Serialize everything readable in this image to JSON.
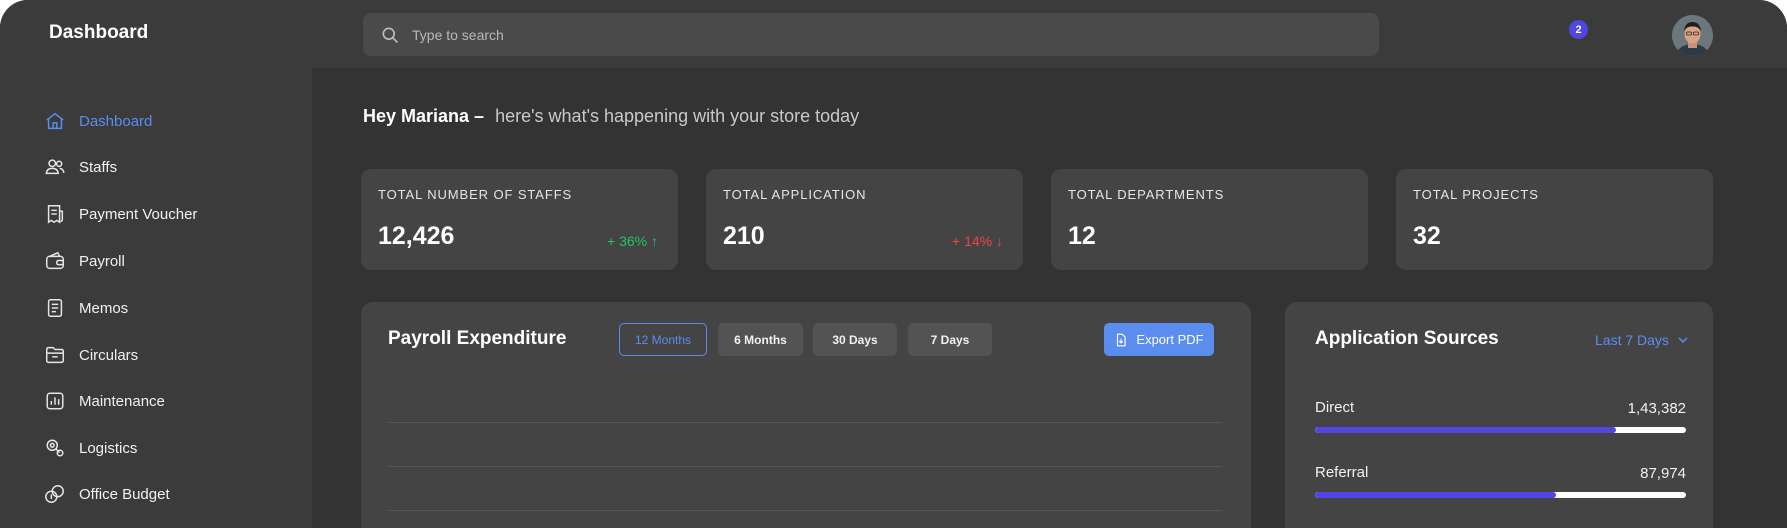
{
  "app": {
    "brand": "Dashboard"
  },
  "search": {
    "placeholder": "Type to search"
  },
  "notifications": {
    "count": "2"
  },
  "sidebar": {
    "items": [
      {
        "label": "Dashboard",
        "icon": "home-icon",
        "active": true
      },
      {
        "label": "Staffs",
        "icon": "users-icon"
      },
      {
        "label": "Payment Voucher",
        "icon": "receipt-icon"
      },
      {
        "label": "Payroll",
        "icon": "wallet-icon"
      },
      {
        "label": "Memos",
        "icon": "document-icon"
      },
      {
        "label": "Circulars",
        "icon": "folder-icon"
      },
      {
        "label": "Maintenance",
        "icon": "bar-chart-icon"
      },
      {
        "label": "Logistics",
        "icon": "logistics-icon"
      },
      {
        "label": "Office Budget",
        "icon": "coins-icon"
      }
    ]
  },
  "greeting": {
    "name": "Hey Mariana –",
    "message": "here's what's happening with your store today"
  },
  "stats": [
    {
      "title": "TOTAL NUMBER OF STAFFS",
      "value": "12,426",
      "delta": "+ 36% ↑",
      "delta_color": "#22c55e"
    },
    {
      "title": "TOTAL APPLICATION",
      "value": "210",
      "delta": "+ 14% ↓",
      "delta_color": "#ef4444"
    },
    {
      "title": "TOTAL DEPARTMENTS",
      "value": "12",
      "delta": ""
    },
    {
      "title": "TOTAL PROJECTS",
      "value": "32",
      "delta": ""
    }
  ],
  "payroll": {
    "title": "Payroll Expenditure",
    "tabs": [
      {
        "label": "12 Months",
        "active": true
      },
      {
        "label": "6 Months"
      },
      {
        "label": "30 Days"
      },
      {
        "label": "7 Days"
      }
    ],
    "export_label": "Export PDF"
  },
  "sources": {
    "title": "Application Sources",
    "period": "Last 7 Days",
    "items": [
      {
        "label": "Direct",
        "value": "1,43,382",
        "fill": 0.81
      },
      {
        "label": "Referral",
        "value": "87,974",
        "fill": 0.65
      }
    ]
  },
  "colors": {
    "accent": "#5b8def",
    "bar": "#4f46e5",
    "positive": "#22c55e",
    "negative": "#ef4444"
  }
}
